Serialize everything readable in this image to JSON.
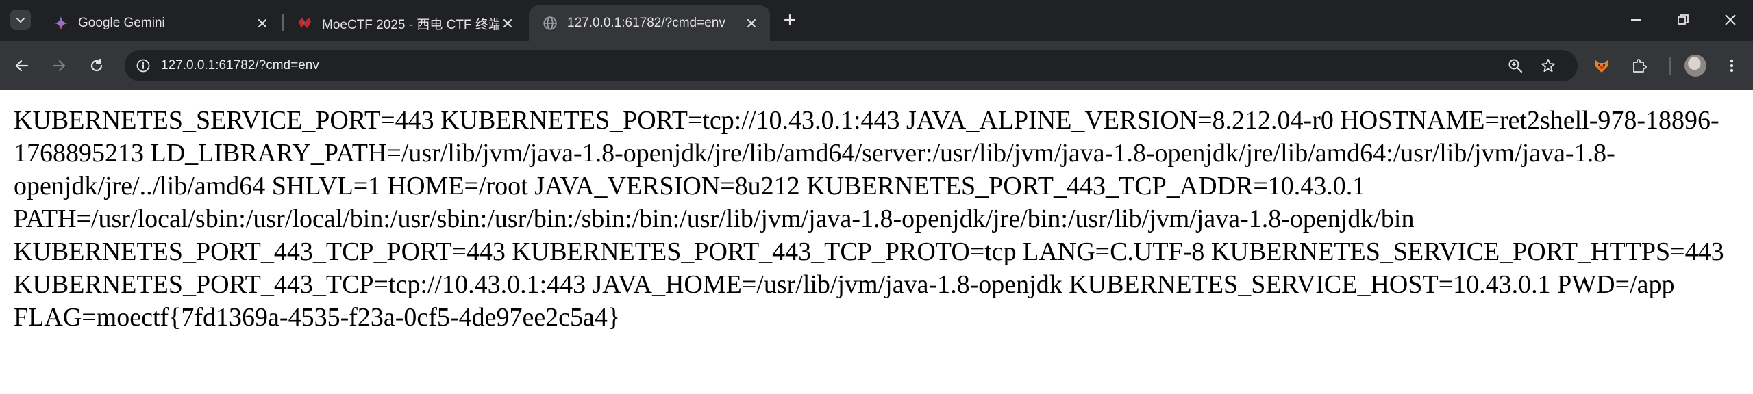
{
  "tabs": [
    {
      "title": "Google Gemini",
      "icon": "gemini-sparkle-icon",
      "active": false
    },
    {
      "title": "MoeCTF 2025 - 西电 CTF 终端",
      "icon": "moectf-logo-icon",
      "active": false
    },
    {
      "title": "127.0.0.1:61782/?cmd=env",
      "icon": "globe-icon",
      "active": true
    }
  ],
  "address_bar": {
    "url": "127.0.0.1:61782/?cmd=env"
  },
  "page": {
    "text": "KUBERNETES_SERVICE_PORT=443 KUBERNETES_PORT=tcp://10.43.0.1:443 JAVA_ALPINE_VERSION=8.212.04-r0 HOSTNAME=ret2shell-978-18896-1768895213 LD_LIBRARY_PATH=/usr/lib/jvm/java-1.8-openjdk/jre/lib/amd64/server:/usr/lib/jvm/java-1.8-openjdk/jre/lib/amd64:/usr/lib/jvm/java-1.8-openjdk/jre/../lib/amd64 SHLVL=1 HOME=/root JAVA_VERSION=8u212 KUBERNETES_PORT_443_TCP_ADDR=10.43.0.1 PATH=/usr/local/sbin:/usr/local/bin:/usr/sbin:/usr/bin:/sbin:/bin:/usr/lib/jvm/java-1.8-openjdk/jre/bin:/usr/lib/jvm/java-1.8-openjdk/bin KUBERNETES_PORT_443_TCP_PORT=443 KUBERNETES_PORT_443_TCP_PROTO=tcp LANG=C.UTF-8 KUBERNETES_SERVICE_PORT_HTTPS=443 KUBERNETES_PORT_443_TCP=tcp://10.43.0.1:443 JAVA_HOME=/usr/lib/jvm/java-1.8-openjdk KUBERNETES_SERVICE_HOST=10.43.0.1 PWD=/app FLAG=moectf{7fd1369a-4535-f23a-0cf5-4de97ee2c5a4}"
  },
  "colors": {
    "tabstrip_bg": "#202124",
    "toolbar_bg": "#35363a",
    "omnibox_bg": "#202124",
    "page_bg": "#ffffff",
    "text_light": "#e3e3e3"
  }
}
